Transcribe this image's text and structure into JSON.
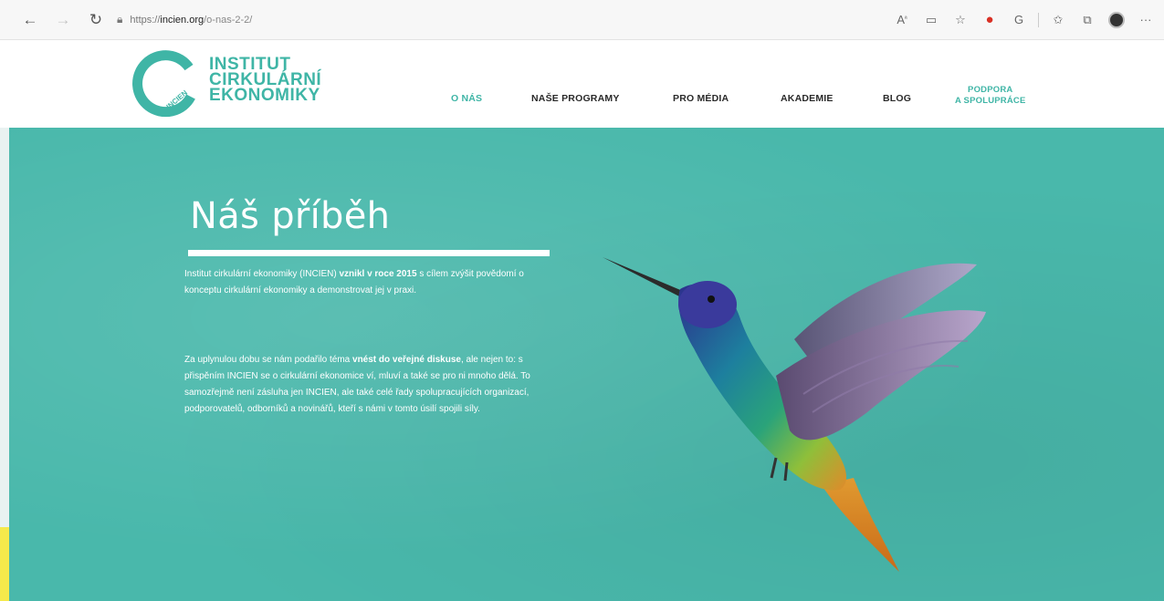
{
  "browser": {
    "url_prefix": "https://",
    "url_host": "incien.org",
    "url_path": "/o-nas-2-2/"
  },
  "site": {
    "logo": {
      "ring_text": "INCIEN",
      "line1": "INSTITUT",
      "line2": "CIRKULÁRNÍ",
      "line3": "EKONOMIKY"
    },
    "nav": {
      "items": [
        {
          "label": "O NÁS"
        },
        {
          "label": "NAŠE PROGRAMY"
        },
        {
          "label": "PRO MÉDIA"
        },
        {
          "label": "AKADEMIE"
        },
        {
          "label": "BLOG"
        }
      ],
      "support_line1": "PODPORA",
      "support_line2": "A SPOLUPRÁCE"
    }
  },
  "hero": {
    "title": "Náš příběh",
    "p1_a": "Institut cirkulární ekonomiky (INCIEN) ",
    "p1_b": "vznikl v roce 2015",
    "p1_c": " s cílem zvýšit povědomí o konceptu cirkulární ekonomiky a demonstrovat jej v praxi.",
    "p2_a": "Za uplynulou dobu se nám podařilo téma ",
    "p2_b": "vnést do veřejné diskuse",
    "p2_c": ", ale nejen to: s přispěním INCIEN se o cirkulární ekonomice ví, mluví a také se pro ni mnoho dělá. To samozřejmě není zásluha jen INCIEN, ale také celé řady spolupracujících organizací, podporovatelů, odborníků a novinářů, kteří s námi v tomto úsilí spojili síly."
  },
  "colors": {
    "brand_teal": "#3fb5a6",
    "hero_bg": "#49b8ab"
  }
}
